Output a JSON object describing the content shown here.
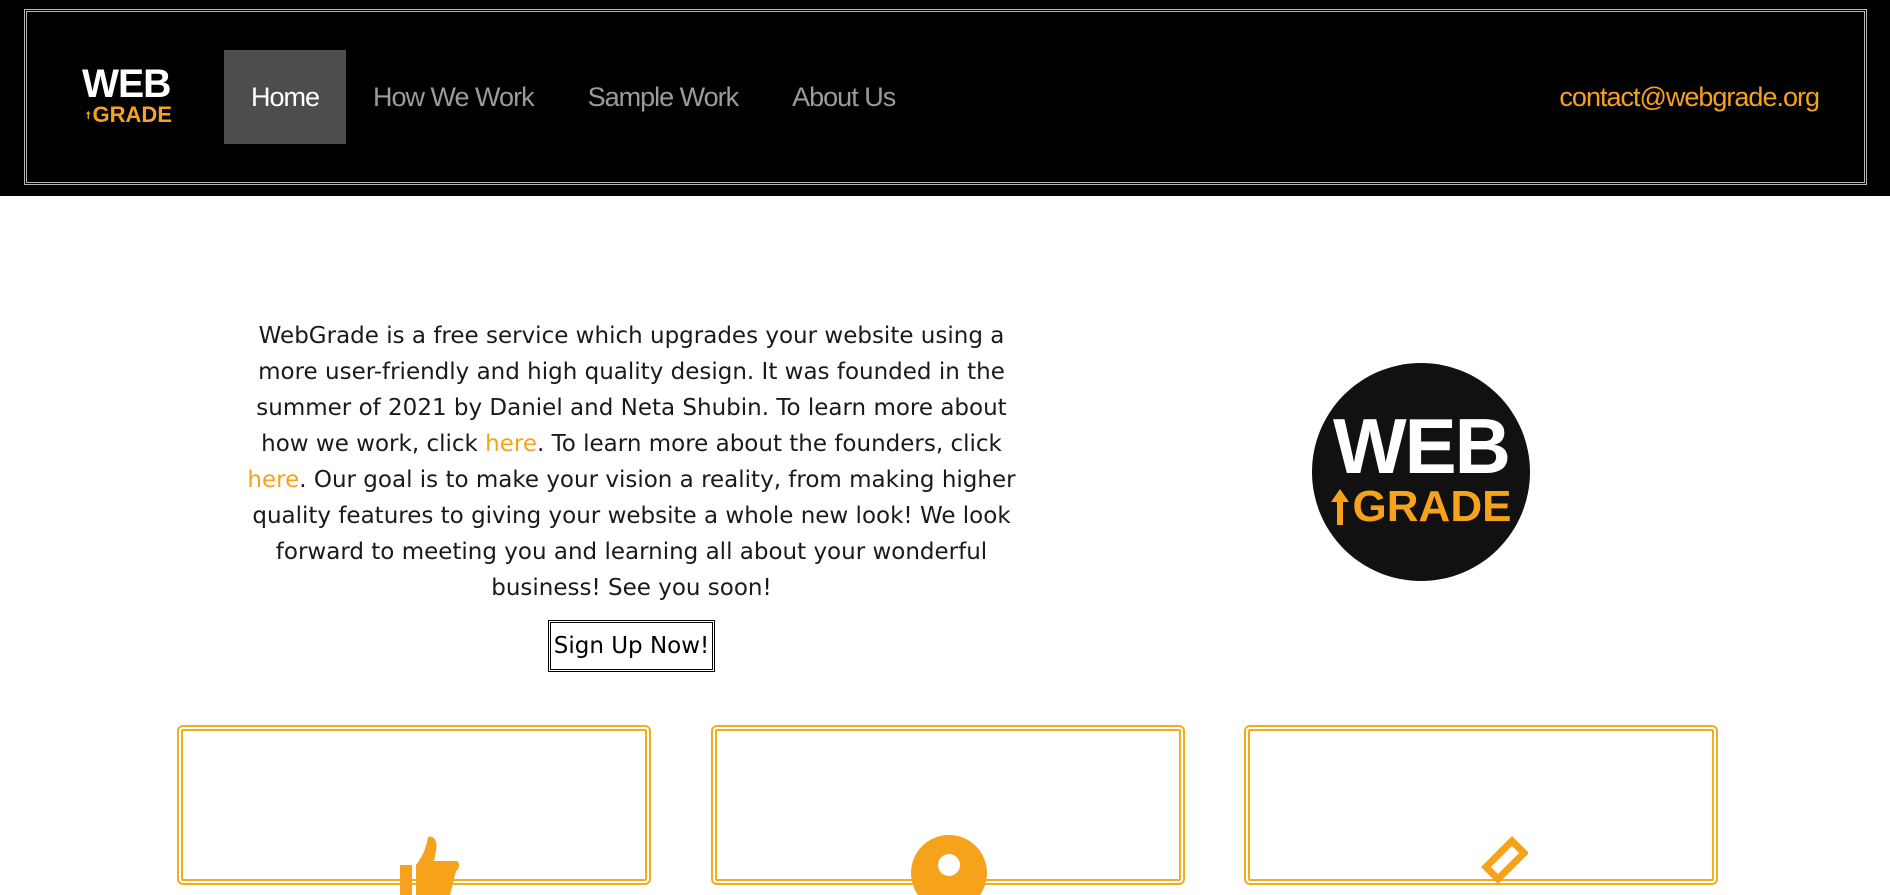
{
  "header": {
    "logo": {
      "top": "WEB",
      "bottom": "GRADE"
    },
    "nav": [
      {
        "label": "Home",
        "active": true
      },
      {
        "label": "How We Work",
        "active": false
      },
      {
        "label": "Sample Work",
        "active": false
      },
      {
        "label": "About Us",
        "active": false
      }
    ],
    "contact_email": "contact@webgrade.org"
  },
  "intro": {
    "part1": "WebGrade is a free service which upgrades your website using a more user-friendly and high quality design. It was founded in the summer of 2021 by Daniel and Neta Shubin. To learn more about how we work, click ",
    "link1": "here",
    "part2": ". To learn more about the founders, click ",
    "link2": "here",
    "part3": ". Our goal is to make your vision a reality, from making higher quality features to giving your website a whole new look! We look forward to meeting you and learning all about your wonderful business! See you soon!"
  },
  "signup_label": "Sign Up Now!",
  "badge": {
    "top": "WEB",
    "bottom": "GRADE"
  },
  "cards": [
    {
      "icon": "thumbs-up-icon"
    },
    {
      "icon": "user-icon"
    },
    {
      "icon": "pencil-icon"
    }
  ],
  "colors": {
    "accent": "#f7a21b",
    "header_bg": "#000000",
    "active_nav": "#4d4d4d",
    "nav_text": "#9b9b9b"
  }
}
